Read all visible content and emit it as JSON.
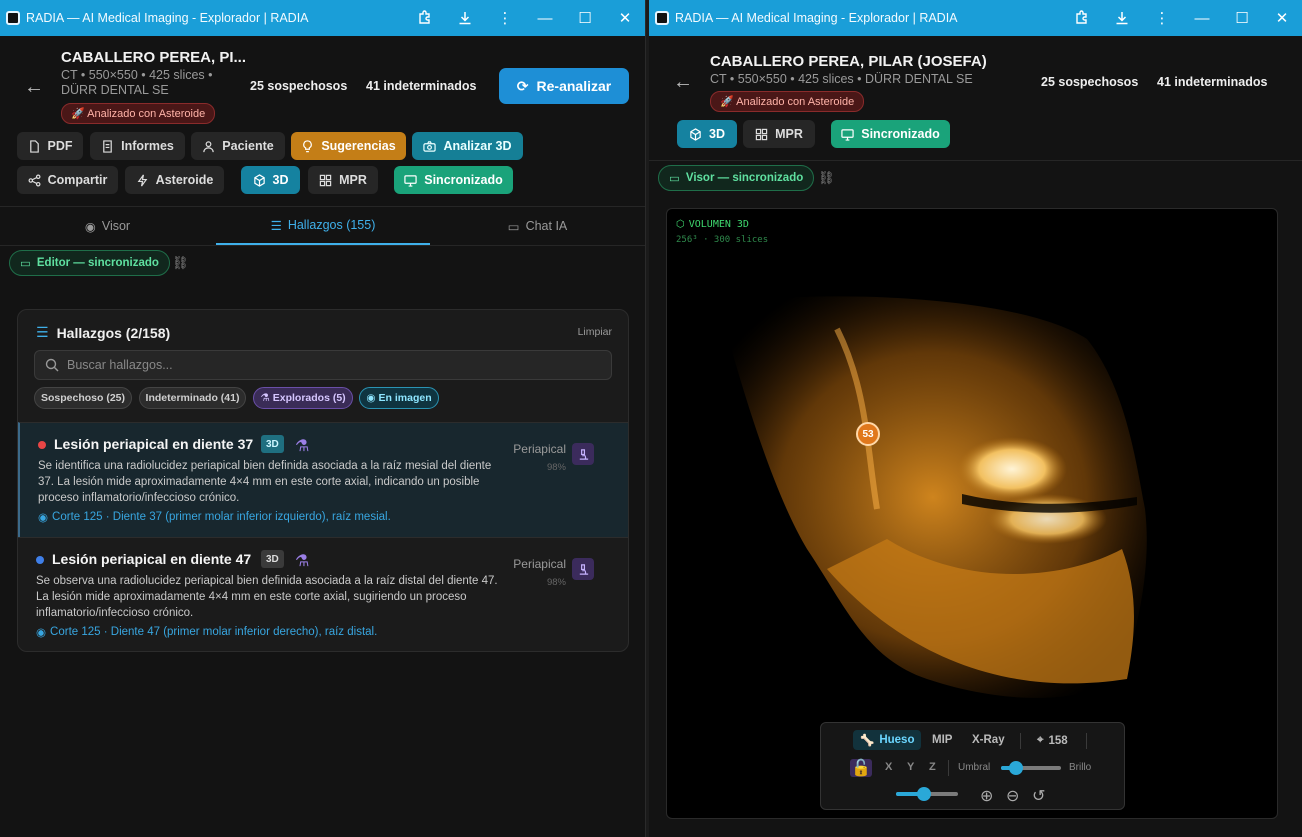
{
  "left_window": {
    "title": "RADIA — AI Medical Imaging - Explorador | RADIA",
    "patient_name": "CABALLERO PEREA, PI...",
    "meta_line1": "CT • 550×550 • 425 slices •",
    "meta_line2": "DÜRR DENTAL SE",
    "asteroid_badge": "Analizado con Asteroide",
    "suspicious": "25 sospechosos",
    "indeterminate": "41 indeterminados",
    "reanalyze": "Re-analizar",
    "toolbar": {
      "pdf": "PDF",
      "reports": "Informes",
      "patient": "Paciente",
      "suggestions": "Sugerencias",
      "analyze3d": "Analizar 3D",
      "share": "Compartir",
      "asteroid": "Asteroide",
      "view3d": "3D",
      "mpr": "MPR",
      "synced": "Sincronizado"
    },
    "tabs": {
      "viewer": "Visor",
      "findings": "Hallazgos (155)",
      "chat": "Chat IA"
    },
    "editor_sync": "Editor — sincronizado",
    "findings_panel": {
      "title": "Hallazgos (2/158)",
      "clear": "Limpiar",
      "search_placeholder": "Buscar hallazgos...",
      "filters": {
        "suspicious": "Sospechoso (25)",
        "indeterminate": "Indeterminado (41)",
        "explored": "Explorados (5)",
        "in_image": "En imagen"
      },
      "items": [
        {
          "title": "Lesión periapical en diente 37",
          "tag": "3D",
          "desc": "Se identifica una radiolucidez periapical bien definida asociada a la raíz mesial del diente 37. La lesión mide aproximadamente 4×4 mm en este corte axial, indicando un posible proceso inflamatorio/infeccioso crónico.",
          "link": "Corte 125 · Diente 37 (primer molar inferior izquierdo), raíz mesial.",
          "type": "Periapical",
          "confidence": "98%",
          "dot_color": "#e84545"
        },
        {
          "title": "Lesión periapical en diente 47",
          "tag": "3D",
          "desc": "Se observa una radiolucidez periapical bien definida asociada a la raíz distal del diente 47. La lesión mide aproximadamente 4×4 mm en este corte axial, sugiriendo un proceso inflamatorio/infeccioso crónico.",
          "link": "Corte 125 · Diente 47 (primer molar inferior derecho), raíz distal.",
          "type": "Periapical",
          "confidence": "98%",
          "dot_color": "#3f7fe8"
        }
      ]
    }
  },
  "right_window": {
    "title": "RADIA — AI Medical Imaging - Explorador | RADIA",
    "patient_name": "CABALLERO PEREA, PILAR (JOSEFA)",
    "meta": "CT • 550×550 • 425 slices • DÜRR DENTAL SE",
    "asteroid_badge": "Analizado con Asteroide",
    "suspicious": "25 sospechosos",
    "indeterminate": "41 indeterminados",
    "toolbar": {
      "view3d": "3D",
      "mpr": "MPR",
      "synced": "Sincronizado"
    },
    "viewer_sync": "Visor — sincronizado",
    "volume_label": "VOLUMEN 3D",
    "volume_sub": "256³ · 300 slices",
    "marker": "53",
    "controls": {
      "bone": "Hueso",
      "mip": "MIP",
      "xray": "X-Ray",
      "count": "158",
      "x": "X",
      "y": "Y",
      "z": "Z",
      "threshold": "Umbral",
      "brightness": "Brillo",
      "threshold_level": 0.25,
      "zoom_level": 0.45
    }
  },
  "colors": {
    "titlebar": "#1a9ed8",
    "accent": "#1e8fd6",
    "green": "#1aa37a",
    "orange": "#c47e17"
  }
}
